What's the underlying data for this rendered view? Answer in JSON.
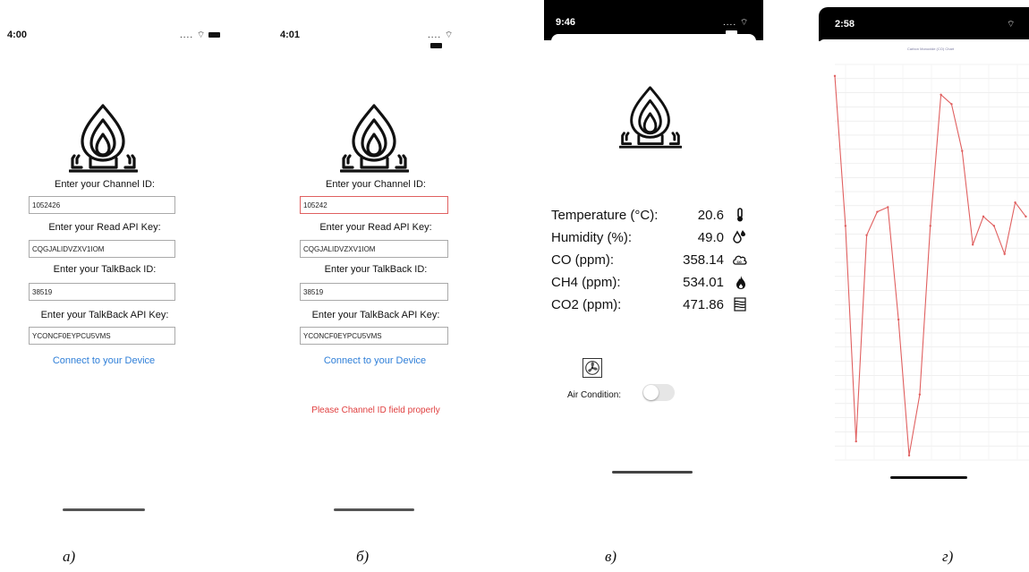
{
  "screens": {
    "a": {
      "time": "4:00",
      "status_icons": ".... ⌔",
      "channel_label": "Enter your Channel ID:",
      "channel_value": "1052426",
      "read_api_label": "Enter your Read API Key:",
      "read_api_value": "CQGJALIDVZXV1IOM",
      "talkback_label": "Enter your TalkBack ID:",
      "talkback_value": "38519",
      "talkback_api_label": "Enter your TalkBack API Key:",
      "talkback_api_value": "YCONCF0EYPCU5VMS",
      "connect_label": "Connect to your Device"
    },
    "b": {
      "time": "4:01",
      "status_icons": ".... ⌔",
      "channel_label": "Enter your Channel ID:",
      "channel_value": "105242",
      "read_api_label": "Enter your Read API Key:",
      "read_api_value": "CQGJALIDVZXV1IOM",
      "talkback_label": "Enter your TalkBack ID:",
      "talkback_value": "38519",
      "talkback_api_label": "Enter your TalkBack API Key:",
      "talkback_api_value": "YCONCF0EYPCU5VMS",
      "connect_label": "Connect to your Device",
      "error_text": "Please Channel ID field properly"
    },
    "c": {
      "time": "9:46",
      "status_icons": ".... ⌔",
      "readings": [
        {
          "label": "Temperature (°C):",
          "value": "20.6",
          "icon": "thermometer-icon"
        },
        {
          "label": "Humidity (%):",
          "value": "49.0",
          "icon": "humidity-icon"
        },
        {
          "label": "CO (ppm):",
          "value": "358.14",
          "icon": "co-cloud-icon"
        },
        {
          "label": "CH4 (ppm):",
          "value": "534.01",
          "icon": "flame-icon"
        },
        {
          "label": "CO2 (ppm):",
          "value": "471.86",
          "icon": "co2-layers-icon"
        }
      ],
      "air_condition_label": "Air Condition:",
      "air_condition_on": false
    },
    "d": {
      "time": "2:58",
      "status_icons": "⌔"
    }
  },
  "chart_data": {
    "type": "line",
    "title": "Carbon Monoxide (CO) Chart",
    "color": "#e06060",
    "values": [
      410,
      250,
      20,
      240,
      265,
      270,
      150,
      5,
      70,
      250,
      390,
      380,
      330,
      230,
      260,
      250,
      220,
      275,
      260
    ]
  },
  "captions": [
    "а)",
    "б)",
    "в)",
    "г)"
  ]
}
